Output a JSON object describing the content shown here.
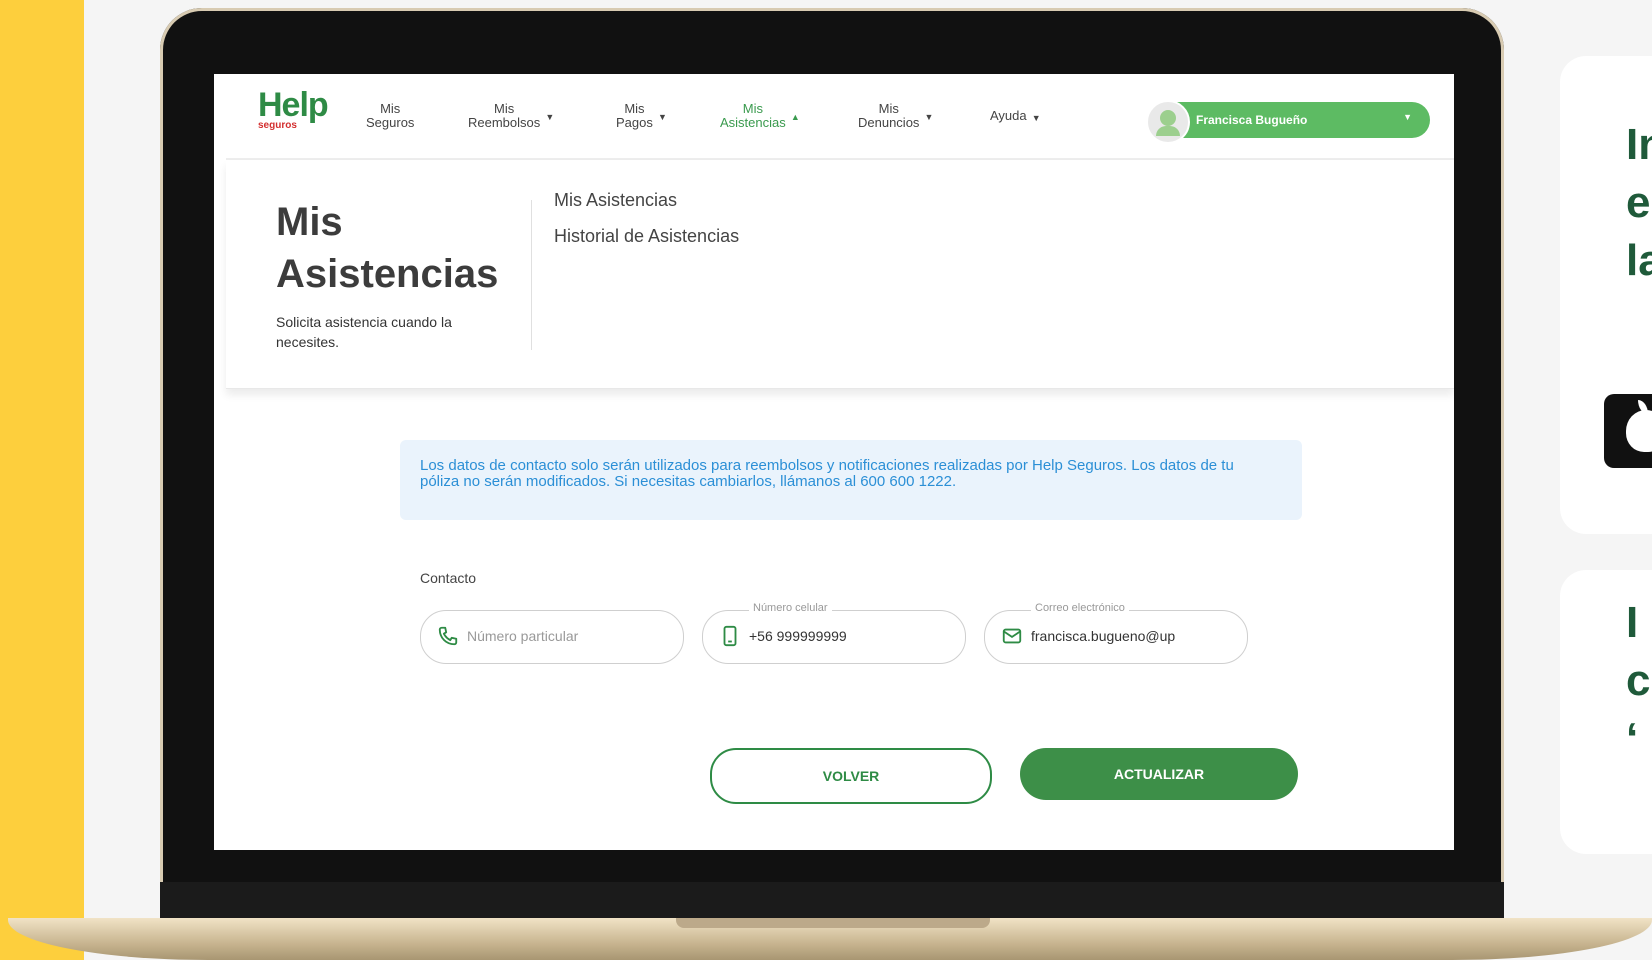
{
  "colors": {
    "brand_green": "#3a9a4e",
    "user_pill": "#5dbb63",
    "info_text": "#2b8fd6",
    "info_bg": "#eaf3fc",
    "accent_yellow": "#fdcf3d"
  },
  "logo": {
    "main": "Help",
    "sub": "seguros"
  },
  "nav": {
    "items": [
      {
        "label": "Mis\nSeguros",
        "line1": "Mis",
        "line2": "Seguros",
        "dropdown": false
      },
      {
        "line1": "Mis",
        "line2": "Reembolsos",
        "dropdown": true
      },
      {
        "line1": "Mis",
        "line2": "Pagos",
        "dropdown": true
      },
      {
        "line1": "Mis",
        "line2": "Asistencias",
        "dropdown": true,
        "active": true
      },
      {
        "line1": "Mis",
        "line2": "Denuncios",
        "dropdown": true
      },
      {
        "line1": "Ayuda",
        "line2": "",
        "dropdown": true
      }
    ],
    "user": {
      "name": "Francisca Bugueño",
      "icon": "avatar-icon"
    }
  },
  "header": {
    "title_line1": "Mis",
    "title_line2": "Asistencias",
    "description": "Solicita asistencia cuando la necesites.",
    "links": [
      "Mis Asistencias",
      "Historial de Asistencias"
    ]
  },
  "info": {
    "text": "Los datos de contacto solo serán utilizados para reembolsos y notificaciones realizadas por Help Seguros. Los datos de tu póliza no serán modificados. Si necesitas cambiarlos, llámanos al 600 600 1222."
  },
  "contact": {
    "label": "Contacto",
    "fields": [
      {
        "label": "",
        "placeholder": "Número particular",
        "value": "",
        "icon": "phone-icon"
      },
      {
        "label": "Número celular",
        "value": "+56 999999999",
        "icon": "mobile-icon"
      },
      {
        "label": "Correo electrónico",
        "value": "francisca.bugueno@up",
        "icon": "mail-icon"
      }
    ]
  },
  "buttons": {
    "back": "VOLVER",
    "update": "ACTUALIZAR"
  },
  "side": {
    "top_text": [
      "In",
      "e",
      "la"
    ],
    "bottom_text": [
      "I",
      "c",
      "‘"
    ],
    "badge_icon": "apple-icon"
  }
}
